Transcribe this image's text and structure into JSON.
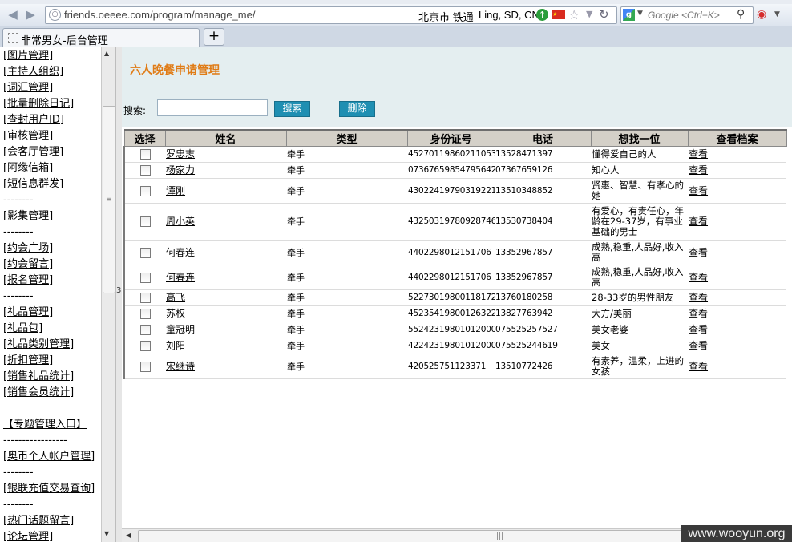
{
  "browser": {
    "url": "friends.oeeee.com/program/manage_me/",
    "geo_city": "北京市 铁通",
    "geo_loc": "Ling, SD, CN",
    "search_placeholder": "Google <Ctrl+K>",
    "tab_title": "非常男女-后台管理",
    "newtab_label": "+"
  },
  "sidebar": {
    "items": [
      "[图片管理]",
      "[主持人组织]",
      "[词汇管理]",
      "[批量删除日记]",
      "[查封用户ID]",
      "[审核管理]",
      "[会客厅管理]",
      "[阿缘信箱]",
      "[短信息群发]",
      "--------",
      "[影集管理]",
      "--------",
      "[约会广场]",
      "[约会留言]",
      "[报名管理]",
      "--------",
      "[礼品管理]",
      "[礼品包]",
      "[礼品类别管理]",
      "[折扣管理]",
      "[销售礼品统计]",
      "[销售会员统计]",
      "",
      "【专题管理入口】",
      "-----------------",
      "[奥币个人帐户管理]",
      "--------",
      "[银联充值交易查询]",
      "--------",
      "[热门话题留言]",
      "[论坛管理]"
    ]
  },
  "splitter_mark": "3",
  "main": {
    "title": "六人晚餐申请管理",
    "search_label": "搜索:",
    "search_value": "",
    "search_button": "搜索",
    "delete_button": "删除",
    "columns": [
      "选择",
      "姓名",
      "类型",
      "身份证号",
      "电话",
      "想找一位",
      "查看档案"
    ],
    "rows": [
      {
        "name": "罗忠志",
        "type": "牵手",
        "id": "452701198602110538",
        "phone": "13528471397",
        "seek": "懂得爱自己的人",
        "view": "查看"
      },
      {
        "name": "杨家力",
        "type": "牵手",
        "id": "073676598547956424",
        "phone": "07367659126",
        "seek": "知心人",
        "view": "查看"
      },
      {
        "name": "谭刚",
        "type": "牵手",
        "id": "430224197903192212",
        "phone": "13510348852",
        "seek": "贤惠、智慧、有孝心的她",
        "view": "查看"
      },
      {
        "name": "周小英",
        "type": "牵手",
        "id": "432503197809287465",
        "phone": "13530738404",
        "seek": "有爱心，有责任心，年龄在29-37岁，有事业基础的男士",
        "view": "查看"
      },
      {
        "name": "何春连",
        "type": "牵手",
        "id": "4402298012151706",
        "phone": "13352967857",
        "seek": "成熟,稳重,人品好,收入高",
        "view": "查看"
      },
      {
        "name": "何春连",
        "type": "牵手",
        "id": "4402298012151706",
        "phone": "13352967857",
        "seek": "成熟,稳重,人品好,收入高",
        "view": "查看"
      },
      {
        "name": "高飞",
        "type": "牵手",
        "id": "522730198001181728",
        "phone": "13760180258",
        "seek": "28-33岁的男性朋友",
        "view": "查看"
      },
      {
        "name": "苏权",
        "type": "牵手",
        "id": "452354198001263221",
        "phone": "13827763942",
        "seek": "大方/美丽",
        "view": "查看"
      },
      {
        "name": "童冠明",
        "type": "牵手",
        "id": "552423198010120000",
        "phone": "075525257527",
        "seek": "美女老婆",
        "view": "查看"
      },
      {
        "name": "刘阳",
        "type": "牵手",
        "id": "422423198010120000",
        "phone": "075525244619",
        "seek": "美女",
        "view": "查看"
      },
      {
        "name": "宋继诗",
        "type": "牵手",
        "id": "420525751123371",
        "phone": "13510772426",
        "seek": "有素养，温柔，上进的女孩",
        "view": "查看"
      }
    ]
  },
  "watermark": "www.wooyun.org"
}
